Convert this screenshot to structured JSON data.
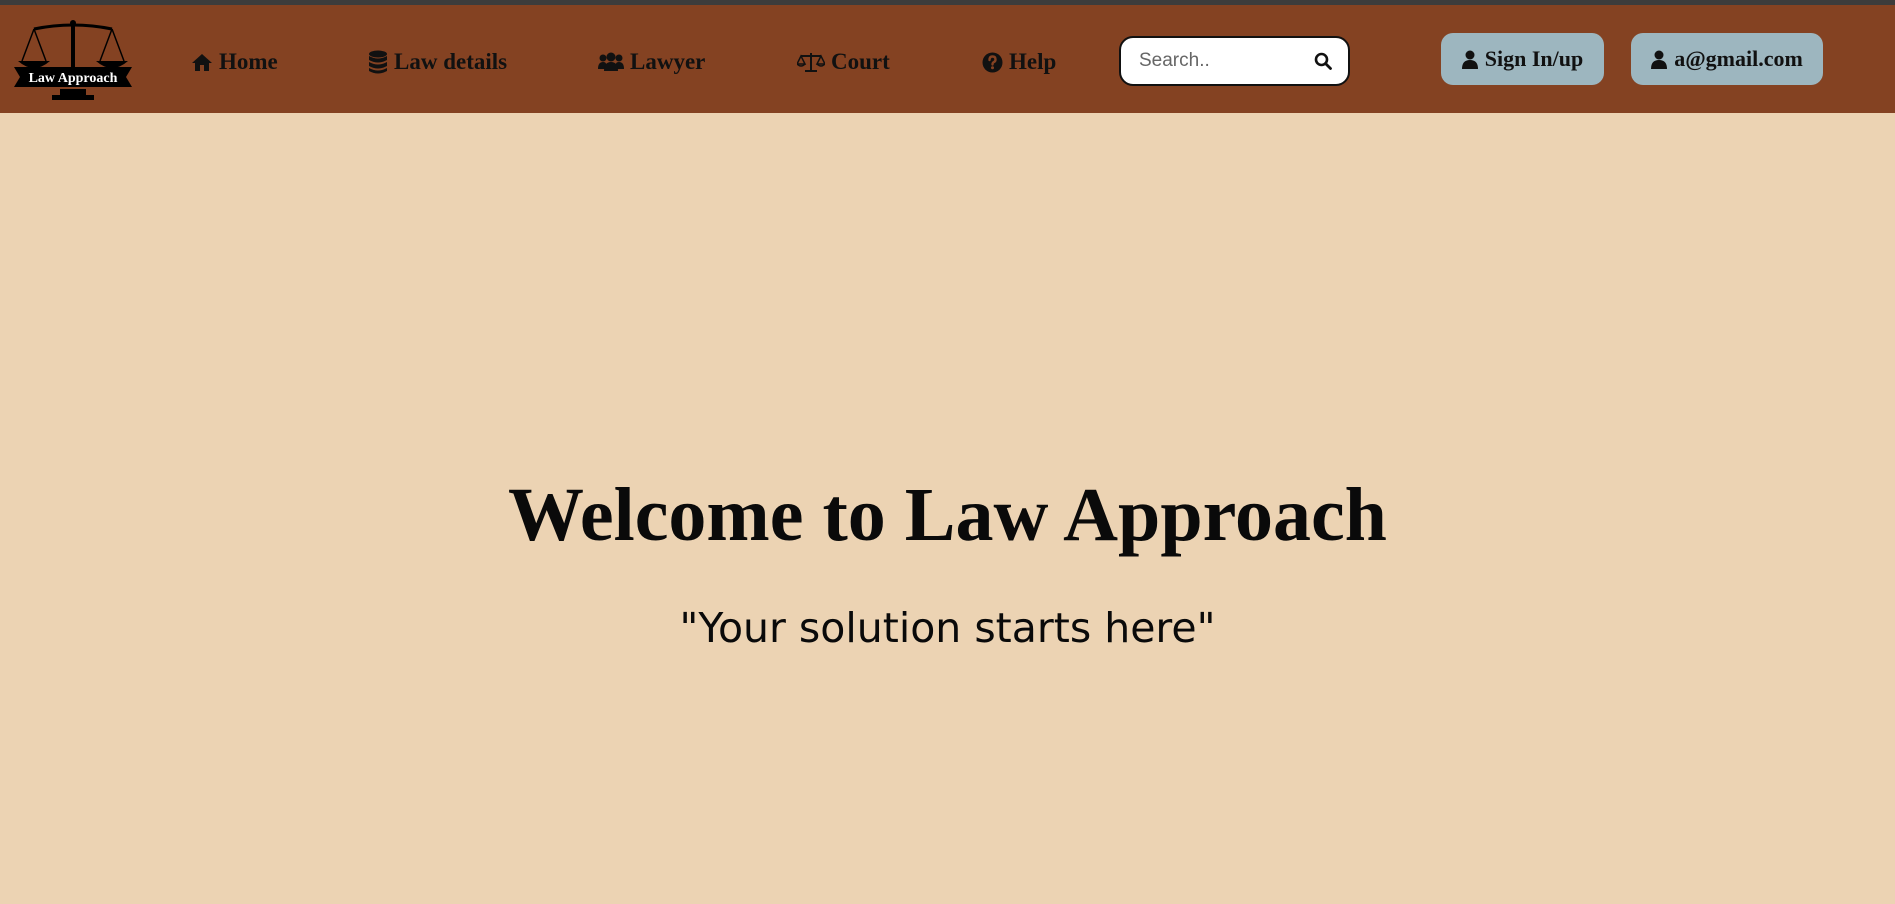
{
  "brand": {
    "logo_text": "Law Approach"
  },
  "nav": {
    "items": [
      {
        "label": "Home",
        "icon": "home-icon"
      },
      {
        "label": "Law details",
        "icon": "database-icon"
      },
      {
        "label": "Lawyer",
        "icon": "users-icon"
      },
      {
        "label": "Court",
        "icon": "balance-scale-icon"
      },
      {
        "label": "Help",
        "icon": "question-circle-icon"
      }
    ]
  },
  "search": {
    "placeholder": "Search..",
    "icon": "search-icon"
  },
  "account": {
    "signin_label": "Sign In/up",
    "user_label": "a@gmail.com",
    "icon": "user-icon"
  },
  "hero": {
    "title": "Welcome to Law Approach",
    "subtitle": "\"Your solution starts here\""
  },
  "colors": {
    "navbar": "#844222",
    "page_background": "#ecd3b3",
    "button_background": "#9db6bf"
  }
}
